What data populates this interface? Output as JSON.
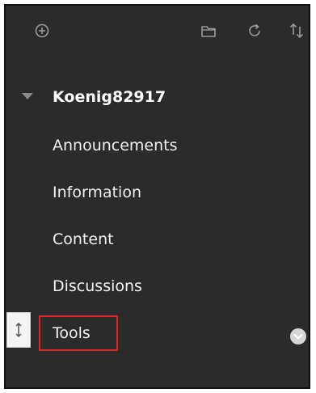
{
  "toolbar": {
    "add_icon": "add-circle-icon",
    "folder_icon": "folder-icon",
    "refresh_icon": "refresh-icon",
    "sort_icon": "sort-icon"
  },
  "course": {
    "title": "Koenig82917",
    "expanded": true
  },
  "menu": {
    "items": [
      {
        "label": "Announcements"
      },
      {
        "label": "Information"
      },
      {
        "label": "Content"
      },
      {
        "label": "Discussions"
      },
      {
        "label": "Tools",
        "highlighted": true
      }
    ]
  },
  "colors": {
    "panel_background": "#2b2b2b",
    "text": "#f2f2f2",
    "highlight_border": "#d9262b"
  }
}
